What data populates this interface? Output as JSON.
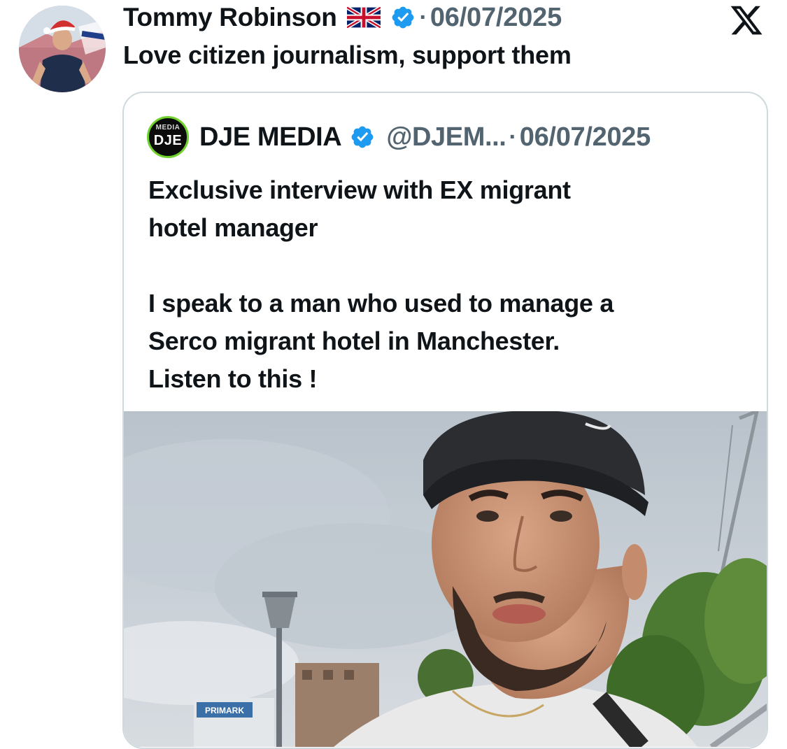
{
  "post": {
    "author_name": "Tommy Robinson",
    "flag_icon": "uk-flag-icon",
    "verified_icon": "verified-badge-icon",
    "separator": "·",
    "date": "06/07/2025",
    "text": "Love citizen journalism, support them",
    "platform_icon": "x-logo-icon"
  },
  "quoted_post": {
    "avatar_text_top": "MEDIA",
    "avatar_text_main": "DJE",
    "author_name": "DJE MEDIA",
    "verified_icon": "verified-badge-icon",
    "handle": "@DJEM...",
    "separator": "·",
    "date": "06/07/2025",
    "text_line_1": "Exclusive interview with EX migrant",
    "text_line_2": "hotel manager",
    "text_line_3": "I speak to a man who used to manage a",
    "text_line_4": "Serco migrant hotel in Manchester.",
    "text_line_5": "Listen to this !",
    "media": {
      "type": "video-thumbnail",
      "sign_text": "PRIMARK"
    }
  },
  "colors": {
    "text_primary": "#0f1419",
    "text_secondary": "#536471",
    "verified_blue": "#1d9bf0",
    "border": "#cfd9de"
  }
}
